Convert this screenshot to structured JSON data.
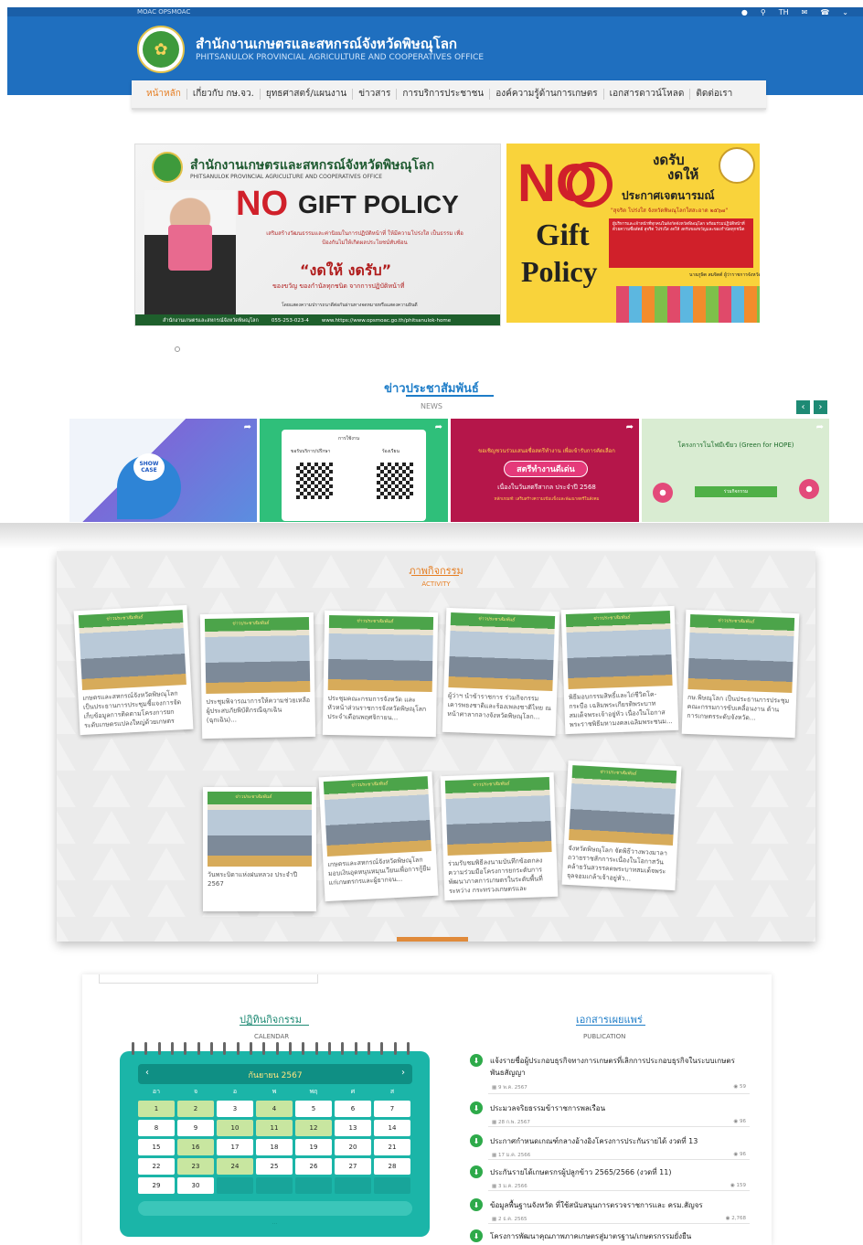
{
  "topbar": {
    "links": "MOAC   OPSMOAC",
    "lang": "TH",
    "icons": [
      "user-icon",
      "search-icon",
      "lang-icon",
      "mail-icon",
      "phone-icon",
      "chevron-down-icon"
    ]
  },
  "header": {
    "title": "สำนักงานเกษตรและสหกรณ์จังหวัดพิษณุโลก",
    "subtitle": "PHITSANULOK PROVINCIAL AGRICULTURE AND COOPERATIVES OFFICE"
  },
  "nav": [
    "หน้าหลัก",
    "เกี่ยวกับ กษ.จว.",
    "ยุทธศาสตร์/แผนงาน",
    "ข่าวสาร",
    "การบริการประชาชน",
    "องค์ความรู้ด้านการเกษตร",
    "เอกสารดาวน์โหลด",
    "ติดต่อเรา"
  ],
  "banner1": {
    "title": "สำนักงานเกษตรและสหกรณ์จังหวัดพิษณุโลก",
    "subtitle": "PHITSANULOK PROVINCIAL AGRICULTURE AND COOPERATIVES OFFICE",
    "no": "NO",
    "gift": "GIFT POLICY",
    "text1": "เสริมสร้างวัฒนธรรมและค่านิยมในการปฏิบัติหน้าที่ ให้มีความโปร่งใส เป็นธรรม เพื่อป้องกันไม่ให้เกิดผลประโยชน์ทับซ้อน",
    "slogan": "“งดให้ งดรับ”",
    "text2": "ของขวัญ ของกำนัลทุกชนิด จากการปฏิบัติหน้าที่",
    "text3": "โดยแสดงความปรารถนาดีต่อกันผ่านทางจดหมายหรือแสดงความยินดี",
    "footer": [
      "สำนักงานเกษตรและสหกรณ์จังหวัดพิษณุโลก",
      "055-253-023-4",
      "www.https://www.opsmoac.go.th/phitsanulok-home"
    ]
  },
  "banner2": {
    "no": "NO",
    "gift": "Gift",
    "policy": "Policy",
    "h1": "งดรับ",
    "h2": "งดให้",
    "h3": "ประกาศเจตนารมณ์",
    "h4": "\"สุจริต โปร่งใส จังหวัดพิษณุโลกใสสะอาด ๒๕๖๗\"",
    "box": "ผู้บริหารและเจ้าหน้าที่ทุกคนในสังกัดจังหวัดพิษณุโลก พร้อมร่วมปฏิบัติหน้าที่ด้วยความซื่อสัตย์ สุจริต โปร่งใส งดให้ งดรับของขวัญและของกำนัลทุกชนิด",
    "sig": "นายภูษิต สมจิตต์ ผู้ว่าราชการจังหวัดพิษณุโลก"
  },
  "news": {
    "title": "ข่าวประชาสัมพันธ์",
    "sub": "NEWS",
    "prev": "‹",
    "next": "›",
    "cards": [
      {
        "badge": "SHOW CASE"
      },
      {
        "title": "การใช้งาน",
        "left": "ขอรับบริการ/ปรึกษา",
        "right": "ร้องเรียน"
      },
      {
        "title": "ขอเชิญชวนร่วมเสนอชื่อสตรีทำงาน เพื่อเข้ารับการคัดเลือก",
        "pill": "สตรีทำงานดีเด่น",
        "sub": "เนื่องในวันสตรีสากล ประจำปี 2568",
        "note": "หลักเกณฑ์: เสริมสร้างความเข้มแข็งและพัฒนาสตรีในสังคม"
      },
      {
        "title": "โครงการโนโฟมีเขียว (Green for HOPE)",
        "bar": "ร่วมกิจกรรม"
      }
    ]
  },
  "activity": {
    "title": "ภาพกิจกรรม",
    "sub": "ACTIVITY",
    "header_text": "ข่าวประชาสัมพันธ์",
    "items": [
      "เกษตรและสหกรณ์จังหวัดพิษณุโลก เป็นประธานการประชุมชี้แจงการจัดเก็บข้อมูลการติดตามโครงการยกระดับเกษตรแปลงใหญ่ด้วยเกษตรสมัย...",
      "ประชุมพิจารณาการให้ความช่วยเหลือผู้ประสบภัยพิบัติกรณีฉุกเฉิน (ฉุกเฉิน)...",
      "ประชุมคณะกรมการจังหวัด และหัวหน้าส่วนราชการจังหวัดพิษณุโลก ประจำเดือนพฤศจิกายน...",
      "ผู้ว่าฯ นำข้าราชการ ร่วมกิจกรรมเคารพธงชาติและร้องเพลงชาติไทย ณ หน้าศาลากลางจังหวัดพิษณุโลก...",
      "พิธีมอบกรรมสิทธิ์และไถ่ชีวิตโค-กระบือ เฉลิมพระเกียรติพระบาทสมเด็จพระเจ้าอยู่หัว เนื่องในโอกาสพระราชพิธีมหามงคลเฉลิมพระชนม...",
      "กษ.พิษณุโลก เป็นประธานการประชุมคณะกรรมการขับเคลื่อนงาน ด้านการเกษตรระดับจังหวัด...",
      "วันพระบิดาแห่งฝนหลวง ประจำปี 2567",
      "เกษตรและสหกรณ์จังหวัดพิษณุโลกมอบเงินอุดหนุนหมุนเวียนเพื่อการกู้ยืมแก่เกษตรกรและผู้ยากจน...",
      "ร่วมรับชมพิธีลงนามบันทึกข้อตกลงความร่วมมือโครงการยกระดับการพัฒนาภาคการเกษตรในระดับพื้นที่ ระหว่าง กระทรวงเกษตรและสหกรณ์...",
      "จังหวัดพิษณุโลก จัดพิธีวางพวงมาลาถวายราชสักการะเนื่องในโอกาสวันคล้ายวันสวรรคตพระบาทสมเด็จพระจุลจอมเกล้าเจ้าอยู่หัว..."
    ]
  },
  "calendar": {
    "title": "ปฏิทินกิจกรรม",
    "sub": "CALENDAR",
    "month": "กันยายน 2567",
    "prev": "‹",
    "next": "›",
    "dots": "...",
    "days": [
      "อา",
      "จ",
      "อ",
      "พ",
      "พฤ",
      "ศ",
      "ส"
    ],
    "dates": [
      "1",
      "2",
      "3",
      "4",
      "5",
      "6",
      "7",
      "8",
      "9",
      "10",
      "11",
      "12",
      "13",
      "14",
      "15",
      "16",
      "17",
      "18",
      "19",
      "20",
      "21",
      "22",
      "23",
      "24",
      "25",
      "26",
      "27",
      "28",
      "29",
      "30"
    ],
    "event_dates": [
      "1",
      "2",
      "4",
      "10",
      "11",
      "12",
      "16",
      "23",
      "24"
    ]
  },
  "publication": {
    "title": "เอกสารเผยแพร่",
    "sub": "PUBLICATION",
    "items": [
      {
        "title": "แจ้งรายชื่อผู้ประกอบธุรกิจทางการเกษตรที่เลิกการประกอบธุรกิจในระบบเกษตรพันธสัญญา",
        "date": "9 พ.ค. 2567",
        "views": "59"
      },
      {
        "title": "ประมวลจริยธรรมข้าราชการพลเรือน",
        "date": "28 ก.พ. 2567",
        "views": "96"
      },
      {
        "title": "ประกาศกำหนดเกณฑ์กลางอ้างอิงโครงการประกันรายได้ งวดที่ 13",
        "date": "17 ม.ค. 2566",
        "views": "96"
      },
      {
        "title": "ประกันรายได้เกษตรกรผู้ปลูกข้าว 2565/2566 (งวดที่ 11)",
        "date": "3 ม.ค. 2566",
        "views": "159"
      },
      {
        "title": "ข้อมูลพื้นฐานจังหวัด ที่ใช้สนับสนุนการตรวจราชการและ ครม.สัญจร",
        "date": "2 ธ.ค. 2565",
        "views": "2,768"
      },
      {
        "title": "โครงการพัฒนาคุณภาพภาคเกษตรสู่มาตรฐาน/เกษตรกรรมยั่งยืน",
        "date": "",
        "views": ""
      }
    ]
  }
}
